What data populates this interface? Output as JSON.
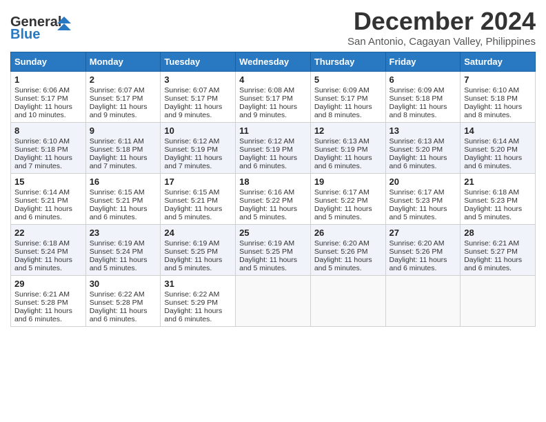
{
  "header": {
    "logo_line1": "General",
    "logo_line2": "Blue",
    "title": "December 2024",
    "subtitle": "San Antonio, Cagayan Valley, Philippines"
  },
  "days_of_week": [
    "Sunday",
    "Monday",
    "Tuesday",
    "Wednesday",
    "Thursday",
    "Friday",
    "Saturday"
  ],
  "weeks": [
    [
      {
        "day": "1",
        "sunrise": "Sunrise: 6:06 AM",
        "sunset": "Sunset: 5:17 PM",
        "daylight": "Daylight: 11 hours and 10 minutes."
      },
      {
        "day": "2",
        "sunrise": "Sunrise: 6:07 AM",
        "sunset": "Sunset: 5:17 PM",
        "daylight": "Daylight: 11 hours and 9 minutes."
      },
      {
        "day": "3",
        "sunrise": "Sunrise: 6:07 AM",
        "sunset": "Sunset: 5:17 PM",
        "daylight": "Daylight: 11 hours and 9 minutes."
      },
      {
        "day": "4",
        "sunrise": "Sunrise: 6:08 AM",
        "sunset": "Sunset: 5:17 PM",
        "daylight": "Daylight: 11 hours and 9 minutes."
      },
      {
        "day": "5",
        "sunrise": "Sunrise: 6:09 AM",
        "sunset": "Sunset: 5:17 PM",
        "daylight": "Daylight: 11 hours and 8 minutes."
      },
      {
        "day": "6",
        "sunrise": "Sunrise: 6:09 AM",
        "sunset": "Sunset: 5:18 PM",
        "daylight": "Daylight: 11 hours and 8 minutes."
      },
      {
        "day": "7",
        "sunrise": "Sunrise: 6:10 AM",
        "sunset": "Sunset: 5:18 PM",
        "daylight": "Daylight: 11 hours and 8 minutes."
      }
    ],
    [
      {
        "day": "8",
        "sunrise": "Sunrise: 6:10 AM",
        "sunset": "Sunset: 5:18 PM",
        "daylight": "Daylight: 11 hours and 7 minutes."
      },
      {
        "day": "9",
        "sunrise": "Sunrise: 6:11 AM",
        "sunset": "Sunset: 5:18 PM",
        "daylight": "Daylight: 11 hours and 7 minutes."
      },
      {
        "day": "10",
        "sunrise": "Sunrise: 6:12 AM",
        "sunset": "Sunset: 5:19 PM",
        "daylight": "Daylight: 11 hours and 7 minutes."
      },
      {
        "day": "11",
        "sunrise": "Sunrise: 6:12 AM",
        "sunset": "Sunset: 5:19 PM",
        "daylight": "Daylight: 11 hours and 6 minutes."
      },
      {
        "day": "12",
        "sunrise": "Sunrise: 6:13 AM",
        "sunset": "Sunset: 5:19 PM",
        "daylight": "Daylight: 11 hours and 6 minutes."
      },
      {
        "day": "13",
        "sunrise": "Sunrise: 6:13 AM",
        "sunset": "Sunset: 5:20 PM",
        "daylight": "Daylight: 11 hours and 6 minutes."
      },
      {
        "day": "14",
        "sunrise": "Sunrise: 6:14 AM",
        "sunset": "Sunset: 5:20 PM",
        "daylight": "Daylight: 11 hours and 6 minutes."
      }
    ],
    [
      {
        "day": "15",
        "sunrise": "Sunrise: 6:14 AM",
        "sunset": "Sunset: 5:21 PM",
        "daylight": "Daylight: 11 hours and 6 minutes."
      },
      {
        "day": "16",
        "sunrise": "Sunrise: 6:15 AM",
        "sunset": "Sunset: 5:21 PM",
        "daylight": "Daylight: 11 hours and 6 minutes."
      },
      {
        "day": "17",
        "sunrise": "Sunrise: 6:15 AM",
        "sunset": "Sunset: 5:21 PM",
        "daylight": "Daylight: 11 hours and 5 minutes."
      },
      {
        "day": "18",
        "sunrise": "Sunrise: 6:16 AM",
        "sunset": "Sunset: 5:22 PM",
        "daylight": "Daylight: 11 hours and 5 minutes."
      },
      {
        "day": "19",
        "sunrise": "Sunrise: 6:17 AM",
        "sunset": "Sunset: 5:22 PM",
        "daylight": "Daylight: 11 hours and 5 minutes."
      },
      {
        "day": "20",
        "sunrise": "Sunrise: 6:17 AM",
        "sunset": "Sunset: 5:23 PM",
        "daylight": "Daylight: 11 hours and 5 minutes."
      },
      {
        "day": "21",
        "sunrise": "Sunrise: 6:18 AM",
        "sunset": "Sunset: 5:23 PM",
        "daylight": "Daylight: 11 hours and 5 minutes."
      }
    ],
    [
      {
        "day": "22",
        "sunrise": "Sunrise: 6:18 AM",
        "sunset": "Sunset: 5:24 PM",
        "daylight": "Daylight: 11 hours and 5 minutes."
      },
      {
        "day": "23",
        "sunrise": "Sunrise: 6:19 AM",
        "sunset": "Sunset: 5:24 PM",
        "daylight": "Daylight: 11 hours and 5 minutes."
      },
      {
        "day": "24",
        "sunrise": "Sunrise: 6:19 AM",
        "sunset": "Sunset: 5:25 PM",
        "daylight": "Daylight: 11 hours and 5 minutes."
      },
      {
        "day": "25",
        "sunrise": "Sunrise: 6:19 AM",
        "sunset": "Sunset: 5:25 PM",
        "daylight": "Daylight: 11 hours and 5 minutes."
      },
      {
        "day": "26",
        "sunrise": "Sunrise: 6:20 AM",
        "sunset": "Sunset: 5:26 PM",
        "daylight": "Daylight: 11 hours and 5 minutes."
      },
      {
        "day": "27",
        "sunrise": "Sunrise: 6:20 AM",
        "sunset": "Sunset: 5:26 PM",
        "daylight": "Daylight: 11 hours and 6 minutes."
      },
      {
        "day": "28",
        "sunrise": "Sunrise: 6:21 AM",
        "sunset": "Sunset: 5:27 PM",
        "daylight": "Daylight: 11 hours and 6 minutes."
      }
    ],
    [
      {
        "day": "29",
        "sunrise": "Sunrise: 6:21 AM",
        "sunset": "Sunset: 5:28 PM",
        "daylight": "Daylight: 11 hours and 6 minutes."
      },
      {
        "day": "30",
        "sunrise": "Sunrise: 6:22 AM",
        "sunset": "Sunset: 5:28 PM",
        "daylight": "Daylight: 11 hours and 6 minutes."
      },
      {
        "day": "31",
        "sunrise": "Sunrise: 6:22 AM",
        "sunset": "Sunset: 5:29 PM",
        "daylight": "Daylight: 11 hours and 6 minutes."
      },
      null,
      null,
      null,
      null
    ]
  ]
}
